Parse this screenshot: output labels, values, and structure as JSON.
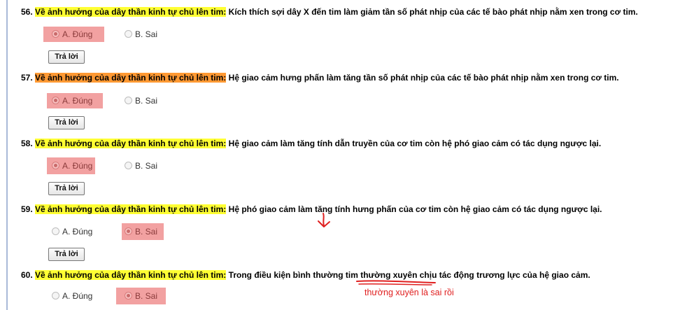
{
  "submit_label": "Trả lời",
  "questions": [
    {
      "number": "56.",
      "topic": "Về ảnh hưởng của dây thần kinh tự chủ lên tim:",
      "text": "Kích thích sợi dây X đến tim làm giảm tần số phát nhịp của các tế bào phát nhịp nằm xen trong cơ tim.",
      "option_a": "A. Đúng",
      "option_b": "B. Sai",
      "selected": "A"
    },
    {
      "number": "57.",
      "topic": "Về ảnh hưởng của dây thần kinh tự chủ lên tim:",
      "text": "Hệ giao cảm hưng phấn làm tăng tần số phát nhịp của các tế bào phát nhịp nằm xen trong cơ tim.",
      "option_a": "A. Đúng",
      "option_b": "B. Sai",
      "selected": "A"
    },
    {
      "number": "58.",
      "topic": "Về ảnh hưởng của dây thần kinh tự chủ lên tim:",
      "text": "Hệ giao cảm làm tăng tính dẫn truyền của cơ tim còn hệ phó giao cảm có tác dụng ngược lại.",
      "option_a": "A. Đúng",
      "option_b": "B. Sai",
      "selected": "A"
    },
    {
      "number": "59.",
      "topic": "Về ảnh hưởng của dây thần kinh tự chủ lên tim:",
      "text": "Hệ phó giao cảm làm tăng tính hưng phấn của cơ tim còn hệ giao cảm có tác dụng ngược lại.",
      "option_a": "A. Đúng",
      "option_b": "B. Sai",
      "selected": "B"
    },
    {
      "number": "60.",
      "topic": "Về ảnh hưởng của dây thần kinh tự chủ lên tim:",
      "text": "Trong điều kiện bình thường tim thường xuyên chịu tác động trương lực của hệ giao cảm.",
      "option_a": "A. Đúng",
      "option_b": "B. Sai",
      "selected": "B"
    }
  ],
  "annotation": {
    "note": "thường xuyên là sai rồi",
    "color": "#e02020"
  },
  "colors": {
    "topic_highlight": "#ffff33",
    "topic_highlight_alt": "#ff9933",
    "selected_option_bg": "#f2a1a1"
  }
}
